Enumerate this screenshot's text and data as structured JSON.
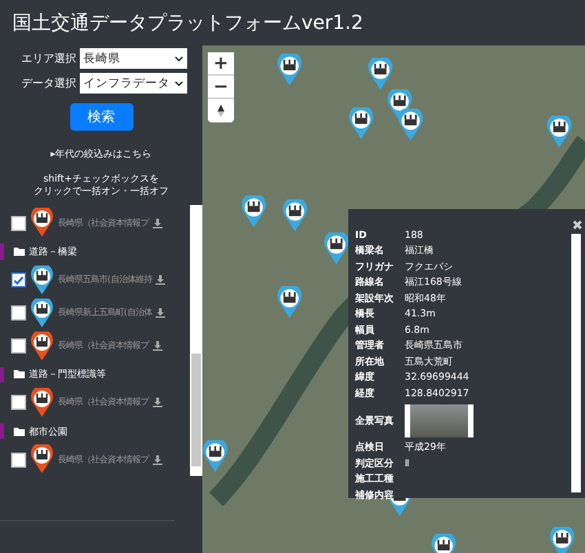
{
  "header": {
    "title": "国土交通データプラットフォームver1.2"
  },
  "filters": [
    {
      "label": "エリア選択",
      "value": "長崎県"
    },
    {
      "label": "データ選択",
      "value": "インフラデータ"
    }
  ],
  "search_button": "検索",
  "era_link": "▸年代の絞込みはこちら",
  "note": [
    "shift+チェックボックスを",
    "クリックで一括オン・一括オフ"
  ],
  "layers": [
    {
      "kind": "layer",
      "checked": false,
      "color": "#e8501e",
      "label": "長崎県（社会資本情報プ"
    },
    {
      "kind": "header",
      "label": "道路－橋梁"
    },
    {
      "kind": "layer",
      "checked": true,
      "color": "#3aa9e0",
      "label": "長崎県五島市(自治体維持"
    },
    {
      "kind": "layer",
      "checked": false,
      "color": "#3aa9e0",
      "label": "長崎県新上五島町(自治体"
    },
    {
      "kind": "layer",
      "checked": false,
      "color": "#e8501e",
      "label": "長崎県（社会資本情報プ"
    },
    {
      "kind": "header",
      "label": "道路－門型標識等"
    },
    {
      "kind": "layer",
      "checked": false,
      "color": "#e8501e",
      "label": "長崎県（社会資本情報プ"
    },
    {
      "kind": "header",
      "label": "都市公園"
    },
    {
      "kind": "layer",
      "checked": false,
      "color": "#e8501e",
      "label": "長崎県（社会資本情報プ"
    }
  ],
  "map_controls": {
    "zoom_in": "+",
    "zoom_out": "−"
  },
  "popup": {
    "rows": [
      {
        "kind": "text",
        "label": "ID",
        "value": "188"
      },
      {
        "kind": "text",
        "label": "橋梁名",
        "value": "福江橋"
      },
      {
        "kind": "text",
        "label": "フリガナ",
        "value": "フクエバシ"
      },
      {
        "kind": "text",
        "label": "路線名",
        "value": "福江168号線"
      },
      {
        "kind": "text",
        "label": "架設年次",
        "value": "昭和48年"
      },
      {
        "kind": "text",
        "label": "橋長",
        "value": "41.3m"
      },
      {
        "kind": "text",
        "label": "幅員",
        "value": "6.8m"
      },
      {
        "kind": "text",
        "label": "管理者",
        "value": "長崎県五島市"
      },
      {
        "kind": "text",
        "label": "所在地",
        "value": "五島大荒町"
      },
      {
        "kind": "text",
        "label": "緯度",
        "value": "32.69699444"
      },
      {
        "kind": "text",
        "label": "経度",
        "value": "128.8402917"
      },
      {
        "kind": "photo",
        "label": "全景写真"
      },
      {
        "kind": "text",
        "label": "点検日",
        "value": "平成29年"
      },
      {
        "kind": "text",
        "label": "判定区分",
        "value": "Ⅱ"
      },
      {
        "kind": "text",
        "label": "施工工種"
      },
      {
        "kind": "text",
        "label": "補修内容"
      }
    ]
  }
}
